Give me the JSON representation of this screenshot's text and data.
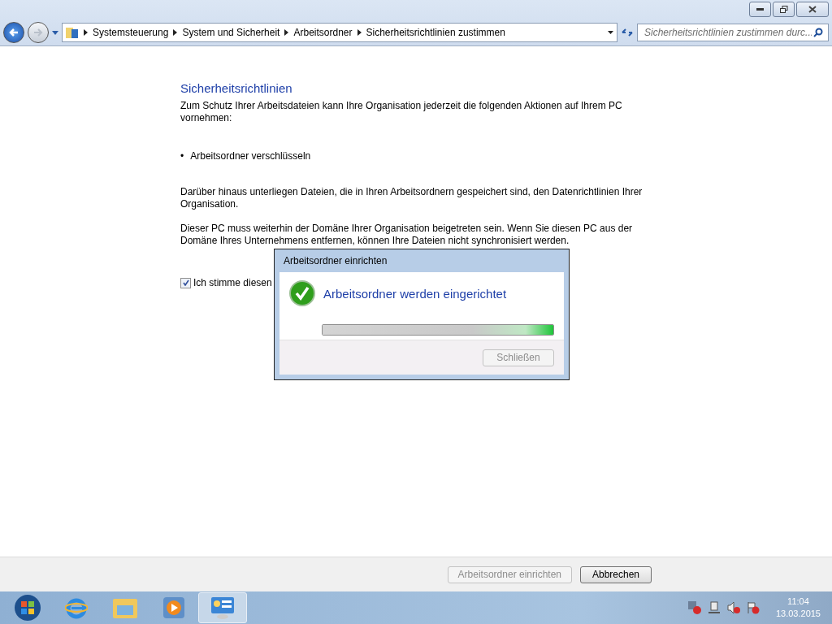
{
  "window": {
    "breadcrumb": [
      "Systemsteuerung",
      "System und Sicherheit",
      "Arbeitsordner",
      "Sicherheitsrichtlinien zustimmen"
    ],
    "search": {
      "placeholder": "Sicherheitsrichtlinien zustimmen durc..."
    }
  },
  "content": {
    "heading": "Sicherheitsrichtlinien",
    "intro": "Zum Schutz Ihrer Arbeitsdateien kann Ihre Organisation jederzeit die folgenden Aktionen auf Ihrem PC vornehmen:",
    "bullets": [
      {
        "marker": "•",
        "text": "Arbeitsordner verschlüsseln"
      }
    ],
    "paragraphs": [
      "Darüber hinaus unterliegen Dateien, die in Ihren Arbeitsordnern gespeichert sind, den Datenrichtlinien Ihrer Organisation.",
      "Dieser PC muss weiterhin der Domäne Ihrer Organisation beigetreten sein. Wenn Sie diesen PC aus der Domäne Ihres Unternehmens entfernen, können Ihre Dateien nicht synchronisiert werden."
    ],
    "agree": {
      "label": "Ich stimme diesen",
      "checked": true
    }
  },
  "footer": {
    "buttons": [
      {
        "label": "Arbeitsordner einrichten",
        "disabled": true
      },
      {
        "label": "Abbrechen",
        "disabled": false
      }
    ]
  },
  "dialog": {
    "title": "Arbeitsordner einrichten",
    "message": "Arbeitsordner werden eingerichtet",
    "progress": {
      "level": 1
    },
    "button": {
      "label": "Schließen",
      "disabled": true
    }
  },
  "taskbar": {
    "time": "11:04",
    "date": "13.03.2015"
  }
}
